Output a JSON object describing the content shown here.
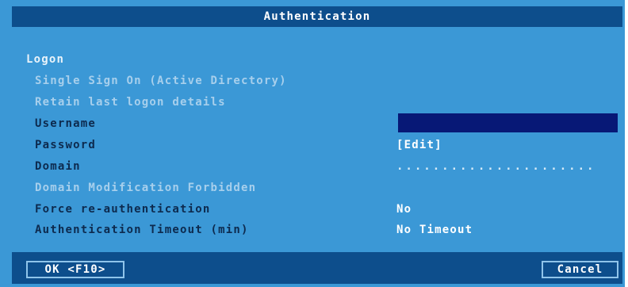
{
  "dialog": {
    "title": "Authentication"
  },
  "section": {
    "logon_label": "Logon"
  },
  "options": {
    "sso_label": "Single Sign On (Active Directory)",
    "retain_label": "Retain last logon details",
    "username_label": "Username",
    "username_value": "",
    "password_label": "Password",
    "password_value": "[Edit]",
    "domain_label": "Domain",
    "domain_value": "......................",
    "domain_mod_label": "Domain Modification Forbidden",
    "force_reauth_label": "Force re-authentication",
    "force_reauth_value": "No",
    "auth_timeout_label": "Authentication Timeout (min)",
    "auth_timeout_value": "No Timeout"
  },
  "buttons": {
    "ok_label": "OK <F10>",
    "cancel_label": "Cancel"
  },
  "colors": {
    "background": "#3b98d6",
    "bar": "#0d4e8c",
    "field_selected": "#071876",
    "disabled_text": "#a7cfec",
    "enabled_text": "#0d2a4e"
  }
}
